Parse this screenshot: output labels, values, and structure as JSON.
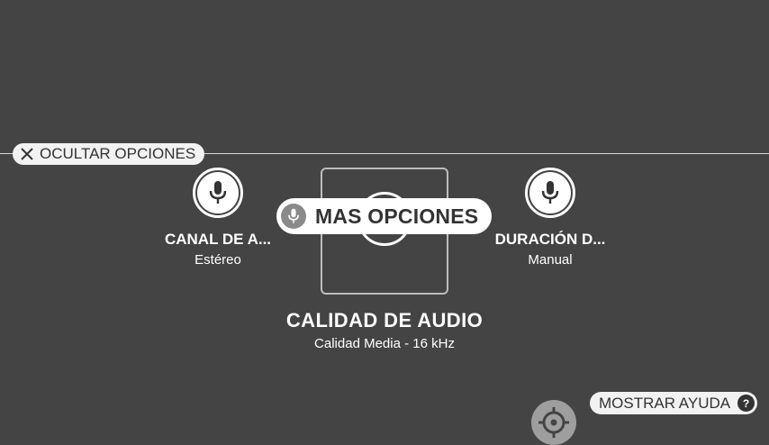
{
  "hide_options": {
    "label": "OCULTAR OPCIONES",
    "icon": "close-icon"
  },
  "options": [
    {
      "title": "CANAL DE A...",
      "value": "Estéreo",
      "icon": "microphone-icon"
    },
    {
      "title": "DURACIÓN D...",
      "value": "Manual",
      "icon": "microphone-icon"
    }
  ],
  "more_options": {
    "label": "MAS OPCIONES",
    "icon": "microphone-icon"
  },
  "selected": {
    "title": "CALIDAD DE AUDIO",
    "value": "Calidad Media - 16 kHz"
  },
  "help": {
    "label": "MOSTRAR AYUDA",
    "icon_text": "?"
  },
  "colors": {
    "background": "#444444",
    "pill": "#f2f2f2",
    "accent": "#ffffff"
  }
}
